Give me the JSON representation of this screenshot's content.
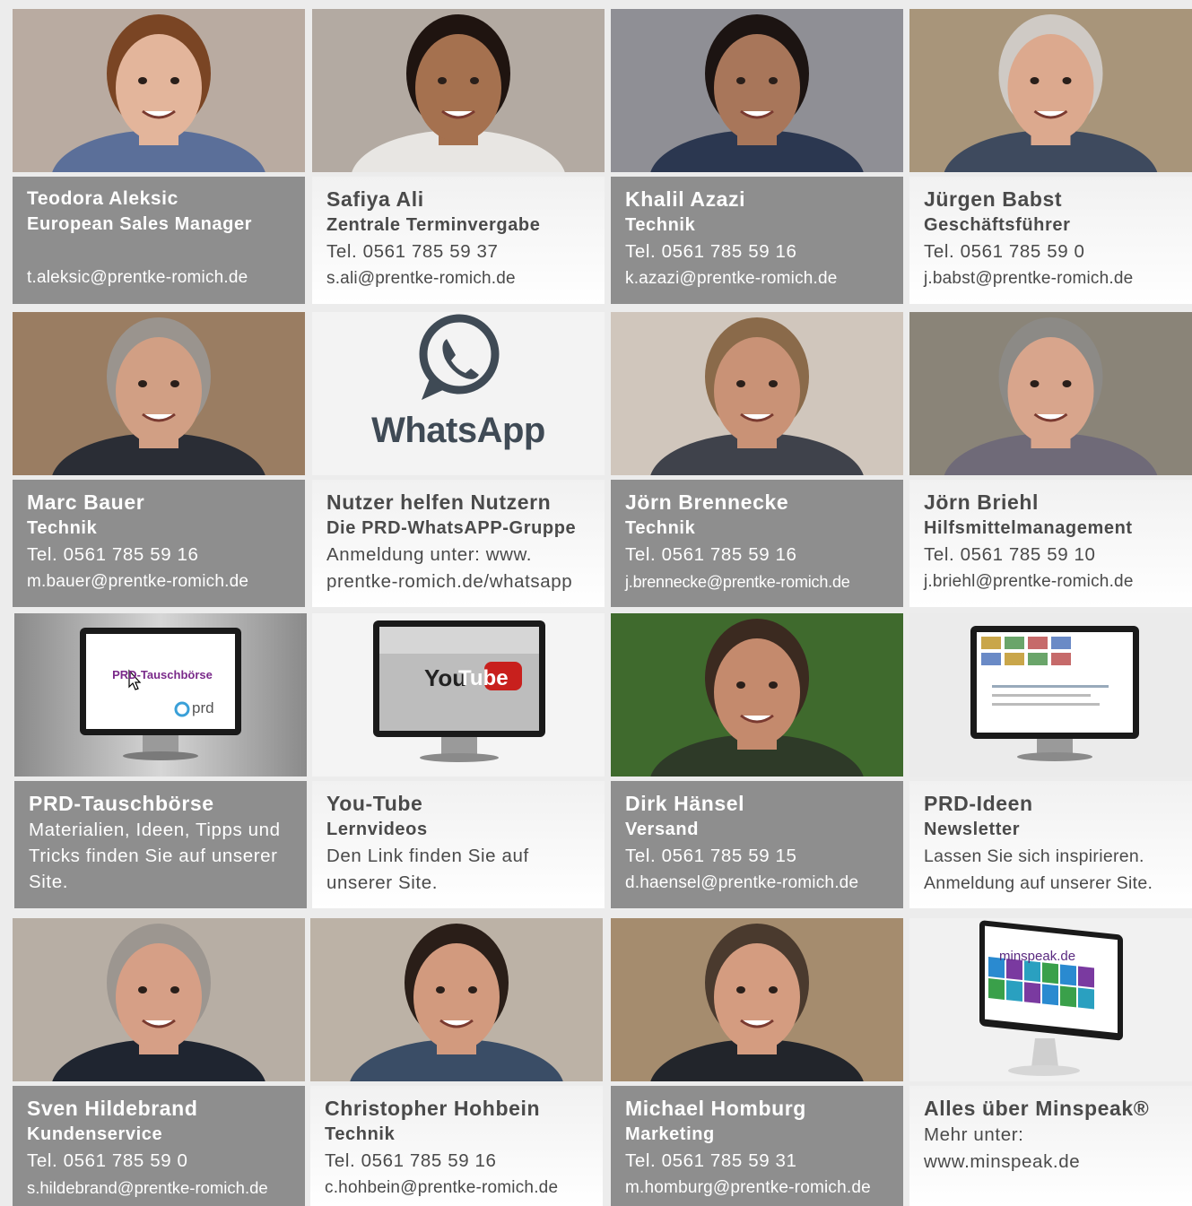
{
  "cards": [
    {
      "name": "Teodora Aleksic",
      "role": "European Sales Manager",
      "tel": "",
      "email": "t.aleksic@prentke-romich.de",
      "photo": {
        "bg": "#b9aba1",
        "skin": "#e3b59b",
        "hair": "#7a4524",
        "shirt": "#5b6f99"
      }
    },
    {
      "name": "Safiya Ali",
      "role": "Zentrale Terminvergabe",
      "tel": "Tel. 0561 785 59 37",
      "email": "s.ali@prentke-romich.de",
      "photo": {
        "bg": "#b3aaa2",
        "skin": "#a5714f",
        "hair": "#1f1410",
        "shirt": "#e8e6e3"
      }
    },
    {
      "name": "Khalil Azazi",
      "role": "Technik",
      "tel": "Tel. 0561 785 59 16",
      "email": "k.azazi@prentke-romich.de",
      "photo": {
        "bg": "#8f8f95",
        "skin": "#a8765a",
        "hair": "#1c1412",
        "shirt": "#2b3750"
      }
    },
    {
      "name": "Jürgen Babst",
      "role": "Geschäftsführer",
      "tel": "Tel. 0561 785 59 0",
      "email": "j.babst@prentke-romich.de",
      "photo": {
        "bg": "#a8957a",
        "skin": "#dca98e",
        "hair": "#cfcac5",
        "shirt": "#3e4a5e"
      }
    },
    {
      "name": "Marc Bauer",
      "role": "Technik",
      "tel": "Tel. 0561 785 59 16",
      "email": "m.bauer@prentke-romich.de",
      "photo": {
        "bg": "#9a7d62",
        "skin": "#d19f84",
        "hair": "#9a948e",
        "shirt": "#2a2d35"
      }
    },
    {
      "name": "Nutzer helfen Nutzern",
      "role": "Die PRD-WhatsAPP-Gruppe",
      "tel": "Anmeldung unter: www.",
      "email": "prentke-romich.de/whatsapp",
      "whatsapp_label": "WhatsApp"
    },
    {
      "name": "Jörn Brennecke",
      "role": "Technik",
      "tel": "Tel. 0561 785 59 16",
      "email": "j.brennecke@prentke-romich.de",
      "photo": {
        "bg": "#d0c6bc",
        "skin": "#c99276",
        "hair": "#8a6a4a",
        "shirt": "#3f424b"
      }
    },
    {
      "name": "Jörn Briehl",
      "role": "Hilfsmittelmanagement",
      "tel": "Tel. 0561 785 59 10",
      "email": "j.briehl@prentke-romich.de",
      "photo": {
        "bg": "#8a8478",
        "skin": "#d8a58c",
        "hair": "#8c8a86",
        "shirt": "#6f6a78"
      }
    },
    {
      "name": "PRD-Tauschbörse",
      "role": "",
      "desc": "Materialien, Ideen, Tipps und Tricks finden Sie auf unserer Site.",
      "screen_title": "PRD-Tauschbörse",
      "brand": "prd"
    },
    {
      "name": "You-Tube",
      "role": "Lernvideos",
      "desc": "Den Link finden Sie auf unserer Site.",
      "yt_you": "You",
      "yt_tube": "Tube"
    },
    {
      "name": "Dirk Hänsel",
      "role": "Versand",
      "tel": "Tel. 0561 785 59 15",
      "email": "d.haensel@prentke-romich.de",
      "photo": {
        "bg": "#3f6a2d",
        "skin": "#c48a6d",
        "hair": "#3b2a20",
        "shirt": "#2e3a28"
      }
    },
    {
      "name": "PRD-Ideen",
      "role": "Newsletter",
      "tel": "Lassen Sie sich inspirieren.",
      "email": "Anmeldung auf unserer Site."
    },
    {
      "name": "Sven Hildebrand",
      "role": "Kundenservice",
      "tel": "Tel. 0561 785 59 0",
      "email": "s.hildebrand@prentke-romich.de",
      "photo": {
        "bg": "#b7aea4",
        "skin": "#d69f86",
        "hair": "#9c9690",
        "shirt": "#1f2530"
      }
    },
    {
      "name": "Christopher Hohbein",
      "role": "Technik",
      "tel": "Tel. 0561 785 59 16",
      "email": "c.hohbein@prentke-romich.de",
      "photo": {
        "bg": "#bcb2a6",
        "skin": "#d29a7e",
        "hair": "#2a1e18",
        "shirt": "#3a4d66"
      }
    },
    {
      "name": "Michael Homburg",
      "role": "Marketing",
      "tel": "Tel. 0561 785 59 31",
      "email": "m.homburg@prentke-romich.de",
      "photo": {
        "bg": "#a58c6e",
        "skin": "#d49c80",
        "hair": "#4a3a2e",
        "shirt": "#22252b"
      }
    },
    {
      "name": "Alles über Minspeak®",
      "role": "",
      "tel": "Mehr unter:",
      "email": "www.minspeak.de",
      "site_label": "minspeak.de"
    }
  ]
}
